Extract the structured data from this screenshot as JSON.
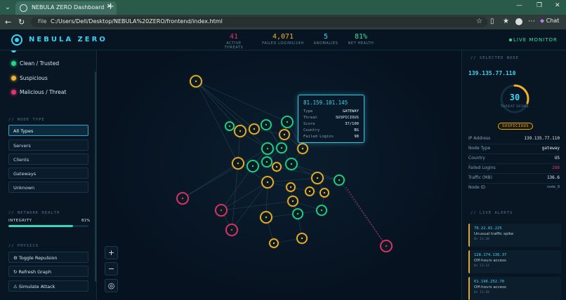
{
  "browser": {
    "tab_title": "NEBULA ZERO Dashboard",
    "url_prefix": "File",
    "url": "C:/Users/Dell/Desktop/NEBULA%20ZERO/frontend/index.html",
    "chat_label": "Chat"
  },
  "header": {
    "brand": "NEBULA ZERO",
    "stats": [
      {
        "value": "41",
        "label": "ACTIVE THREATS",
        "color": "#e0356a"
      },
      {
        "value": "4,071",
        "label": "FAILED LOGINS/24H",
        "color": "#f0b22a"
      },
      {
        "value": "5",
        "label": "ANOMALIES",
        "color": "#3fd6f2"
      },
      {
        "value": "81%",
        "label": "NET HEALTH",
        "color": "#34e0a0"
      }
    ],
    "live_label": "LIVE MONITOR"
  },
  "sidebar": {
    "legend": [
      {
        "label": "Clean / Trusted",
        "color": "#1fd68a"
      },
      {
        "label": "Suspicious",
        "color": "#f0b22a"
      },
      {
        "label": "Malicious / Threat",
        "color": "#e0356a"
      }
    ],
    "node_type_title": "// NODE TYPE",
    "filters": [
      "All Types",
      "Servers",
      "Clients",
      "Gateways",
      "Unknown"
    ],
    "network_health_title": "// NETWORK HEALTH",
    "integrity_label": "INTEGRITY",
    "integrity_value": "81%",
    "integrity_fraction": 0.81,
    "physics_title": "// PHYSICS",
    "actions": [
      {
        "icon": "⚙",
        "label": "Toggle Repulsion"
      },
      {
        "icon": "↻",
        "label": "Refresh Graph"
      },
      {
        "icon": "⚠",
        "label": "Simulate Attack"
      }
    ]
  },
  "graph": {
    "zoom_in": "+",
    "zoom_out": "−",
    "recenter": "◎"
  },
  "tooltip": {
    "ip": "81.159.101.145",
    "rows": [
      {
        "k": "Type",
        "v": "GATEWAY"
      },
      {
        "k": "Threat",
        "v": "SUSPICIOUS"
      },
      {
        "k": "Score",
        "v": "37/100"
      },
      {
        "k": "Country",
        "v": "BG"
      },
      {
        "k": "Failed Logins",
        "v": "98"
      }
    ]
  },
  "selected_node": {
    "title": "// SELECTED NODE",
    "ip": "139.135.77.110",
    "score": "30",
    "score_fraction": 0.3,
    "score_label": "THREAT SCORE",
    "badge": "SUSPICIOUS",
    "rows": [
      {
        "k": "IP Address",
        "v": "139.135.77.110"
      },
      {
        "k": "Node Type",
        "v": "gateway"
      },
      {
        "k": "Country",
        "v": "US"
      },
      {
        "k": "Failed Logins",
        "v": "288"
      },
      {
        "k": "Traffic (MB)",
        "v": "136.6"
      },
      {
        "k": "Node ID",
        "v": "node_8"
      }
    ]
  },
  "alerts": {
    "title": "// LIVE ALERTS",
    "items": [
      {
        "ip": "78.22.81.225",
        "msg": "Unusual traffic spike",
        "time": "8s 11:38"
      },
      {
        "ip": "128.174.136.37",
        "msg": "Off-hours access",
        "time": "8s 11:33"
      },
      {
        "ip": "61.196.252.70",
        "msg": "Off-hours access",
        "time": "8s 11:28"
      }
    ]
  }
}
